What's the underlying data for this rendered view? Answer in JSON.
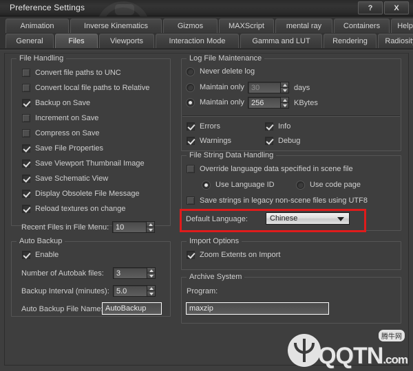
{
  "window": {
    "title": "Preference Settings",
    "help_button": "?",
    "close_button": "X"
  },
  "tabs": {
    "row1": [
      {
        "label": "Animation",
        "active": false
      },
      {
        "label": "Inverse Kinematics",
        "active": false
      },
      {
        "label": "Gizmos",
        "active": false
      },
      {
        "label": "MAXScript",
        "active": false
      },
      {
        "label": "mental ray",
        "active": false
      },
      {
        "label": "Containers",
        "active": false
      },
      {
        "label": "Help",
        "active": false
      }
    ],
    "row2": [
      {
        "label": "General",
        "active": false
      },
      {
        "label": "Files",
        "active": true
      },
      {
        "label": "Viewports",
        "active": false
      },
      {
        "label": "Interaction Mode",
        "active": false
      },
      {
        "label": "Gamma and LUT",
        "active": false
      },
      {
        "label": "Rendering",
        "active": false
      },
      {
        "label": "Radiosity",
        "active": false
      }
    ]
  },
  "file_handling": {
    "title": "File Handling",
    "checkboxes": [
      {
        "label": "Convert file paths to UNC",
        "checked": false
      },
      {
        "label": "Convert local file paths to Relative",
        "checked": false
      },
      {
        "label": "Backup on Save",
        "checked": true
      },
      {
        "label": "Increment on Save",
        "checked": false
      },
      {
        "label": "Compress on Save",
        "checked": false
      },
      {
        "label": "Save File Properties",
        "checked": true
      },
      {
        "label": "Save Viewport Thumbnail Image",
        "checked": true
      },
      {
        "label": "Save Schematic View",
        "checked": true
      },
      {
        "label": "Display Obsolete File Message",
        "checked": true
      },
      {
        "label": "Reload textures on change",
        "checked": true
      }
    ],
    "recent_files_label": "Recent Files in File Menu:",
    "recent_files_value": "10"
  },
  "auto_backup": {
    "title": "Auto Backup",
    "enable_label": "Enable",
    "enable_checked": true,
    "num_files_label": "Number of Autobak files:",
    "num_files_value": "3",
    "interval_label": "Backup Interval (minutes):",
    "interval_value": "5.0",
    "filename_label": "Auto Backup File Name:",
    "filename_value": "AutoBackup"
  },
  "log_file": {
    "title": "Log File Maintenance",
    "radios": [
      {
        "label": "Never delete log",
        "selected": false
      },
      {
        "label": "Maintain only",
        "selected": false
      },
      {
        "label": "Maintain only",
        "selected": true
      }
    ],
    "days_value": "30",
    "days_unit": "days",
    "kbytes_value": "256",
    "kbytes_unit": "KBytes",
    "flags": [
      {
        "label": "Errors",
        "checked": true
      },
      {
        "label": "Info",
        "checked": true
      },
      {
        "label": "Warnings",
        "checked": true
      },
      {
        "label": "Debug",
        "checked": true
      }
    ]
  },
  "file_string": {
    "title": "File String Data Handling",
    "override_label": "Override language data specified in scene file",
    "override_checked": false,
    "use_language_id_label": "Use Language ID",
    "use_language_id_selected": true,
    "use_code_page_label": "Use code page",
    "use_code_page_selected": false,
    "legacy_utf8_label": "Save strings in legacy non-scene files using UTF8",
    "legacy_utf8_checked": false,
    "default_language_label": "Default Language:",
    "default_language_value": "Chinese",
    "highlight_color": "#e01b1b"
  },
  "import_options": {
    "title": "Import Options",
    "zoom_extents_label": "Zoom Extents on Import",
    "zoom_extents_checked": true
  },
  "archive_system": {
    "title": "Archive System",
    "program_label": "Program:",
    "program_value": "maxzip"
  },
  "watermark": {
    "site": "QQTN",
    "domain": ".com",
    "badge": "腾牛网"
  }
}
